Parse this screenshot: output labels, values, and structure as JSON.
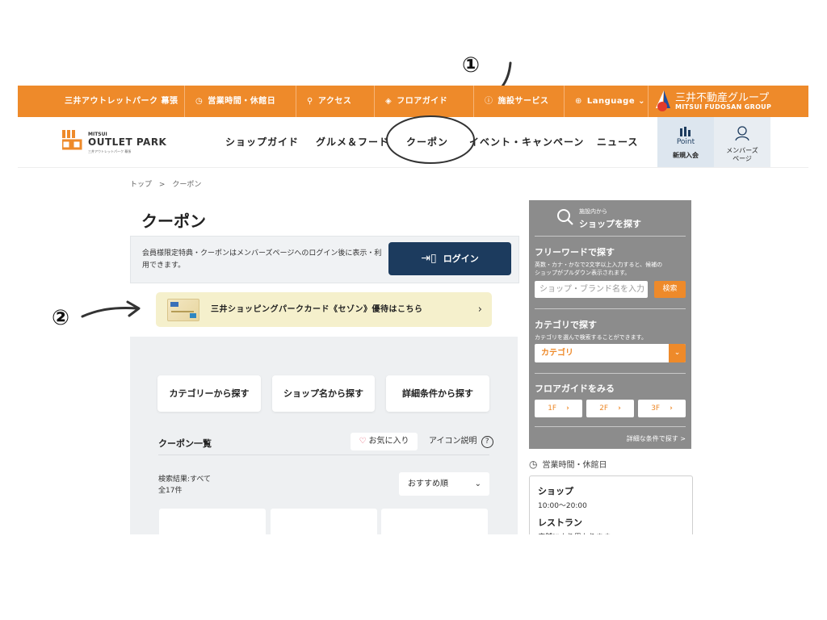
{
  "annotations": {
    "one": "①",
    "two": "②"
  },
  "topbar": {
    "site_name": "三井アウトレットパーク 幕張",
    "hours": "営業時間・休館日",
    "access": "アクセス",
    "floor_guide": "フロアガイド",
    "services": "施設サービス",
    "language": "Language",
    "group_name": "三井不動産グループ",
    "group_name_en": "MITSUI FUDOSAN GROUP",
    "accent_color": "#ee8a2a"
  },
  "header": {
    "logo_small": "MITSUI",
    "logo_main": "OUTLET PARK",
    "logo_sub": "三井アウトレットパーク 幕張",
    "nav": [
      "ショップガイド",
      "グルメ＆フード",
      "クーポン",
      "イベント・キャンペーン",
      "ニュース"
    ],
    "point_label": "Point",
    "point_sub": "新規入会",
    "member_label": "メンバーズ",
    "member_sub": "ページ"
  },
  "breadcrumb": {
    "home": "トップ",
    "sep": ">",
    "current": "クーポン"
  },
  "page_title": "クーポン",
  "notice": {
    "text": "会員様限定特典・クーポンはメンバーズページへのログイン後に表示・利用できます。",
    "login_label": "ログイン"
  },
  "card_banner": {
    "text": "三井ショッピングパークカード《セゾン》優待はこちら",
    "chevron": "›"
  },
  "search_buttons": [
    "カテゴリーから探す",
    "ショップ名から探す",
    "詳細条件から探す"
  ],
  "coupon_list": {
    "title": "クーポン一覧",
    "favorite": "お気に入り",
    "icon_help": "アイコン説明",
    "result_label": "検索結果:すべて",
    "result_count": "全17件",
    "sort_label": "おすすめ順"
  },
  "sidebar": {
    "head_small": "施設内から",
    "head_main": "ショップを探す",
    "freeword_title": "フリーワードで探す",
    "freeword_desc": "英数・カナ・かなで2文字以上入力すると、候補のショップがプルダウン表示されます。",
    "input_placeholder": "ショップ・ブランド名を入力",
    "search_label": "検索",
    "category_title": "カテゴリで探す",
    "category_desc": "カテゴリを選んで検索することができます。",
    "category_select": "カテゴリ",
    "floor_title": "フロアガイドをみる",
    "floors": [
      "1F",
      "2F",
      "3F"
    ],
    "detail_link": "詳細な条件で探す >"
  },
  "hours": {
    "title": "営業時間・休館日",
    "shop_label": "ショップ",
    "shop_time": "10:00〜20:00",
    "restaurant_label": "レストラン",
    "restaurant_note": "店舗により異なります"
  }
}
